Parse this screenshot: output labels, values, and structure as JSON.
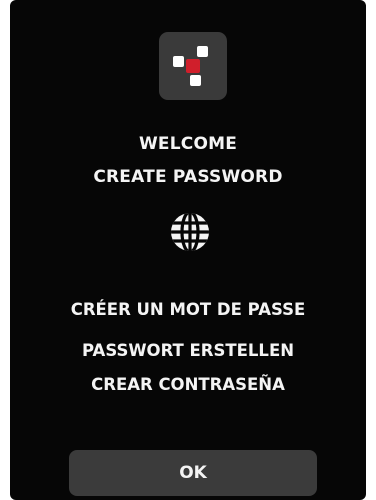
{
  "colors": {
    "screen_background": "#060606",
    "text": "#f4f4f4",
    "logo_tile": "#3a3a3a",
    "logo_accent": "#d01f2b",
    "button_background": "#3b3b3b"
  },
  "header": {
    "logo_icon": "app-logo",
    "welcome": "WELCOME",
    "create_password": "CREATE PASSWORD"
  },
  "language_icon": "globe-icon",
  "translations": {
    "french": "CRÉER UN MOT DE PASSE",
    "german": "PASSWORT ERSTELLEN",
    "spanish": "CREAR CONTRASEÑA"
  },
  "actions": {
    "ok_label": "OK"
  }
}
